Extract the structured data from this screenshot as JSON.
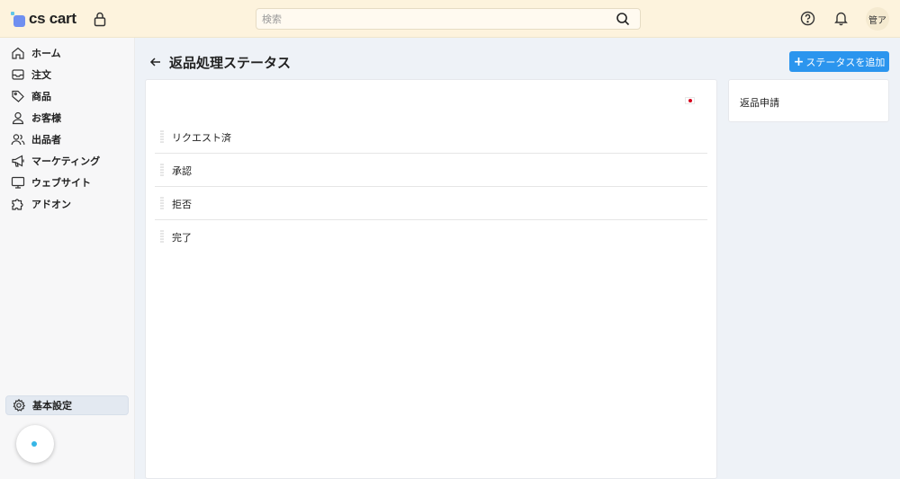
{
  "header": {
    "logo_text": "cs cart",
    "search_placeholder": "検索",
    "avatar_text": "管ア"
  },
  "sidebar": {
    "items": [
      {
        "label": "ホーム",
        "icon": "home-icon"
      },
      {
        "label": "注文",
        "icon": "inbox-icon"
      },
      {
        "label": "商品",
        "icon": "tag-icon"
      },
      {
        "label": "お客様",
        "icon": "user-icon"
      },
      {
        "label": "出品者",
        "icon": "users-icon"
      },
      {
        "label": "マーケティング",
        "icon": "megaphone-icon"
      },
      {
        "label": "ウェブサイト",
        "icon": "monitor-icon"
      },
      {
        "label": "アドオン",
        "icon": "puzzle-icon"
      }
    ],
    "settings_label": "基本設定",
    "settings_icon": "gear-icon"
  },
  "page": {
    "title": "返品処理ステータス",
    "add_button_label": "ステータスを追加"
  },
  "statuses": [
    "リクエスト済",
    "承認",
    "拒否",
    "完了"
  ],
  "side_panel": {
    "link_label": "返品申請"
  },
  "colors": {
    "header_bg": "#fdf3dd",
    "accent": "#2b95ee",
    "sidebar_active_bg": "#e3e9f1"
  }
}
